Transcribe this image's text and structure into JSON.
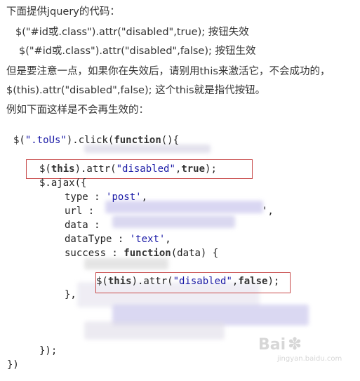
{
  "intro": [
    "下面提供jquery的代码：",
    "$(\"#id或.class\").attr(\"disabled\",true);   按钮失效",
    "$(\"#id或.class\").attr(\"disabled\",false);   按钮生效",
    "但是要注意一点，如果你在失效后，请别用this来激活它，不会成功的，",
    "$(this).attr(\"disabled\",false);   这个this就是指代按钮。",
    "例如下面这样是不会再生效的："
  ],
  "code": {
    "l1": {
      "a": "$(",
      "s": "\".toUs\"",
      "b": ").click(",
      "k": "function",
      "c": "(){"
    },
    "l2": {
      "a": "$(",
      "k1": "this",
      "b": ").attr(",
      "s": "\"disabled\"",
      "c": ",",
      "k2": "true",
      "d": ");"
    },
    "l3": "$.ajax({",
    "l4": {
      "a": "type : ",
      "s": "'post'",
      "b": ","
    },
    "l5": {
      "a": "url : ",
      "c": "',"
    },
    "l6": "data :",
    "l7": {
      "a": "dataType : ",
      "s": "'text'",
      "b": ","
    },
    "l8": {
      "a": "success : ",
      "k": "function",
      "b": "(data) {"
    },
    "l9": {
      "a": "$(",
      "k1": "this",
      "b": ").attr(",
      "s": "\"disabled\"",
      "c": ",",
      "k2": "false",
      "d": ");"
    },
    "l10": "},",
    "l11": "});",
    "l12": "})"
  },
  "watermark": {
    "big": "Bai",
    "small": "jingyan.baidu.com"
  },
  "colors": {
    "highlight_box": "#c84b4b",
    "string": "#1a1aa6"
  }
}
